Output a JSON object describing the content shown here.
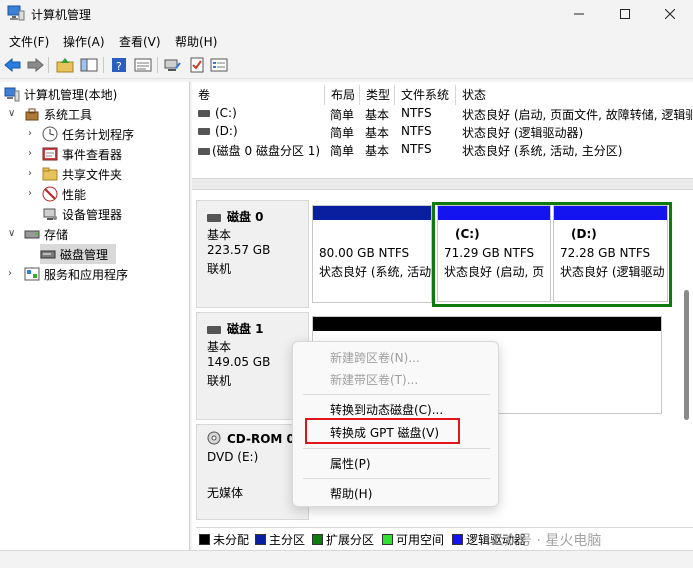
{
  "window": {
    "title": "计算机管理",
    "controls": {
      "minimize": "minimize-icon",
      "maximize": "maximize-icon",
      "close": "close-icon"
    }
  },
  "menu": [
    "文件(F)",
    "操作(A)",
    "查看(V)",
    "帮助(H)"
  ],
  "toolbar_icons": [
    "back-arrow-icon",
    "forward-arrow-icon",
    "up-folder-icon",
    "show-hide-tree-icon",
    "help-icon",
    "properties-icon",
    "connect-icon",
    "check-icon",
    "list-icon"
  ],
  "tree": {
    "root": "计算机管理(本地)",
    "items": [
      {
        "label": "系统工具",
        "icon": "tools-icon"
      },
      {
        "label": "任务计划程序",
        "icon": "clock-icon"
      },
      {
        "label": "事件查看器",
        "icon": "event-viewer-icon"
      },
      {
        "label": "共享文件夹",
        "icon": "shared-folder-icon"
      },
      {
        "label": "性能",
        "icon": "performance-icon"
      },
      {
        "label": "设备管理器",
        "icon": "device-manager-icon"
      },
      {
        "label": "存储",
        "icon": "storage-icon"
      },
      {
        "label": "磁盘管理",
        "icon": "disk-management-icon"
      },
      {
        "label": "服务和应用程序",
        "icon": "services-icon"
      }
    ]
  },
  "volume_list": {
    "headers": [
      "卷",
      "布局",
      "类型",
      "文件系统",
      "状态"
    ],
    "rows": [
      {
        "volume": "(C:)",
        "layout": "简单",
        "type": "基本",
        "fs": "NTFS",
        "status": "状态良好 (启动, 页面文件, 故障转储, 逻辑驱"
      },
      {
        "volume": "(D:)",
        "layout": "简单",
        "type": "基本",
        "fs": "NTFS",
        "status": "状态良好 (逻辑驱动器)"
      },
      {
        "volume": "(磁盘 0 磁盘分区 1)",
        "layout": "简单",
        "type": "基本",
        "fs": "NTFS",
        "status": "状态良好 (系统, 活动, 主分区)"
      }
    ]
  },
  "disks": [
    {
      "name": "磁盘 0",
      "type": "基本",
      "size": "223.57 GB",
      "state": "联机",
      "partitions": [
        {
          "label": "",
          "size": "80.00 GB NTFS",
          "status": "状态良好 (系统, 活动"
        },
        {
          "label": "(C:)",
          "size": "71.29 GB NTFS",
          "status": "状态良好 (启动, 页"
        },
        {
          "label": "(D:)",
          "size": "72.28 GB NTFS",
          "status": "状态良好 (逻辑驱动"
        }
      ]
    },
    {
      "name": "磁盘 1",
      "type": "基本",
      "size": "149.05 GB",
      "state": "联机"
    },
    {
      "name": "CD-ROM 0",
      "type": "DVD (E:)",
      "state": "无媒体"
    }
  ],
  "legend": [
    {
      "label": "未分配",
      "color": "#000000"
    },
    {
      "label": "主分区",
      "color": "#0a1ea0"
    },
    {
      "label": "扩展分区",
      "color": "#0f7a0f"
    },
    {
      "label": "可用空间",
      "color": "#32e032"
    },
    {
      "label": "逻辑驱动器",
      "color": "#1414f0"
    }
  ],
  "context_menu": {
    "items": [
      {
        "label": "新建跨区卷(N)...",
        "enabled": false
      },
      {
        "label": "新建带区卷(T)...",
        "enabled": false
      },
      {
        "label": "转换到动态磁盘(C)...",
        "enabled": true
      },
      {
        "label": "转换成 GPT 磁盘(V)",
        "enabled": true
      },
      {
        "label": "属性(P)",
        "enabled": true
      },
      {
        "label": "帮助(H)",
        "enabled": true
      }
    ]
  },
  "watermark": "公众号 · 星火电脑",
  "colors": {
    "primary_partition": "#0a1ea0",
    "logical_drive": "#1414f0",
    "extended_partition": "#0f7a0f",
    "unallocated": "#000000",
    "highlight_box": "#e0151b"
  }
}
